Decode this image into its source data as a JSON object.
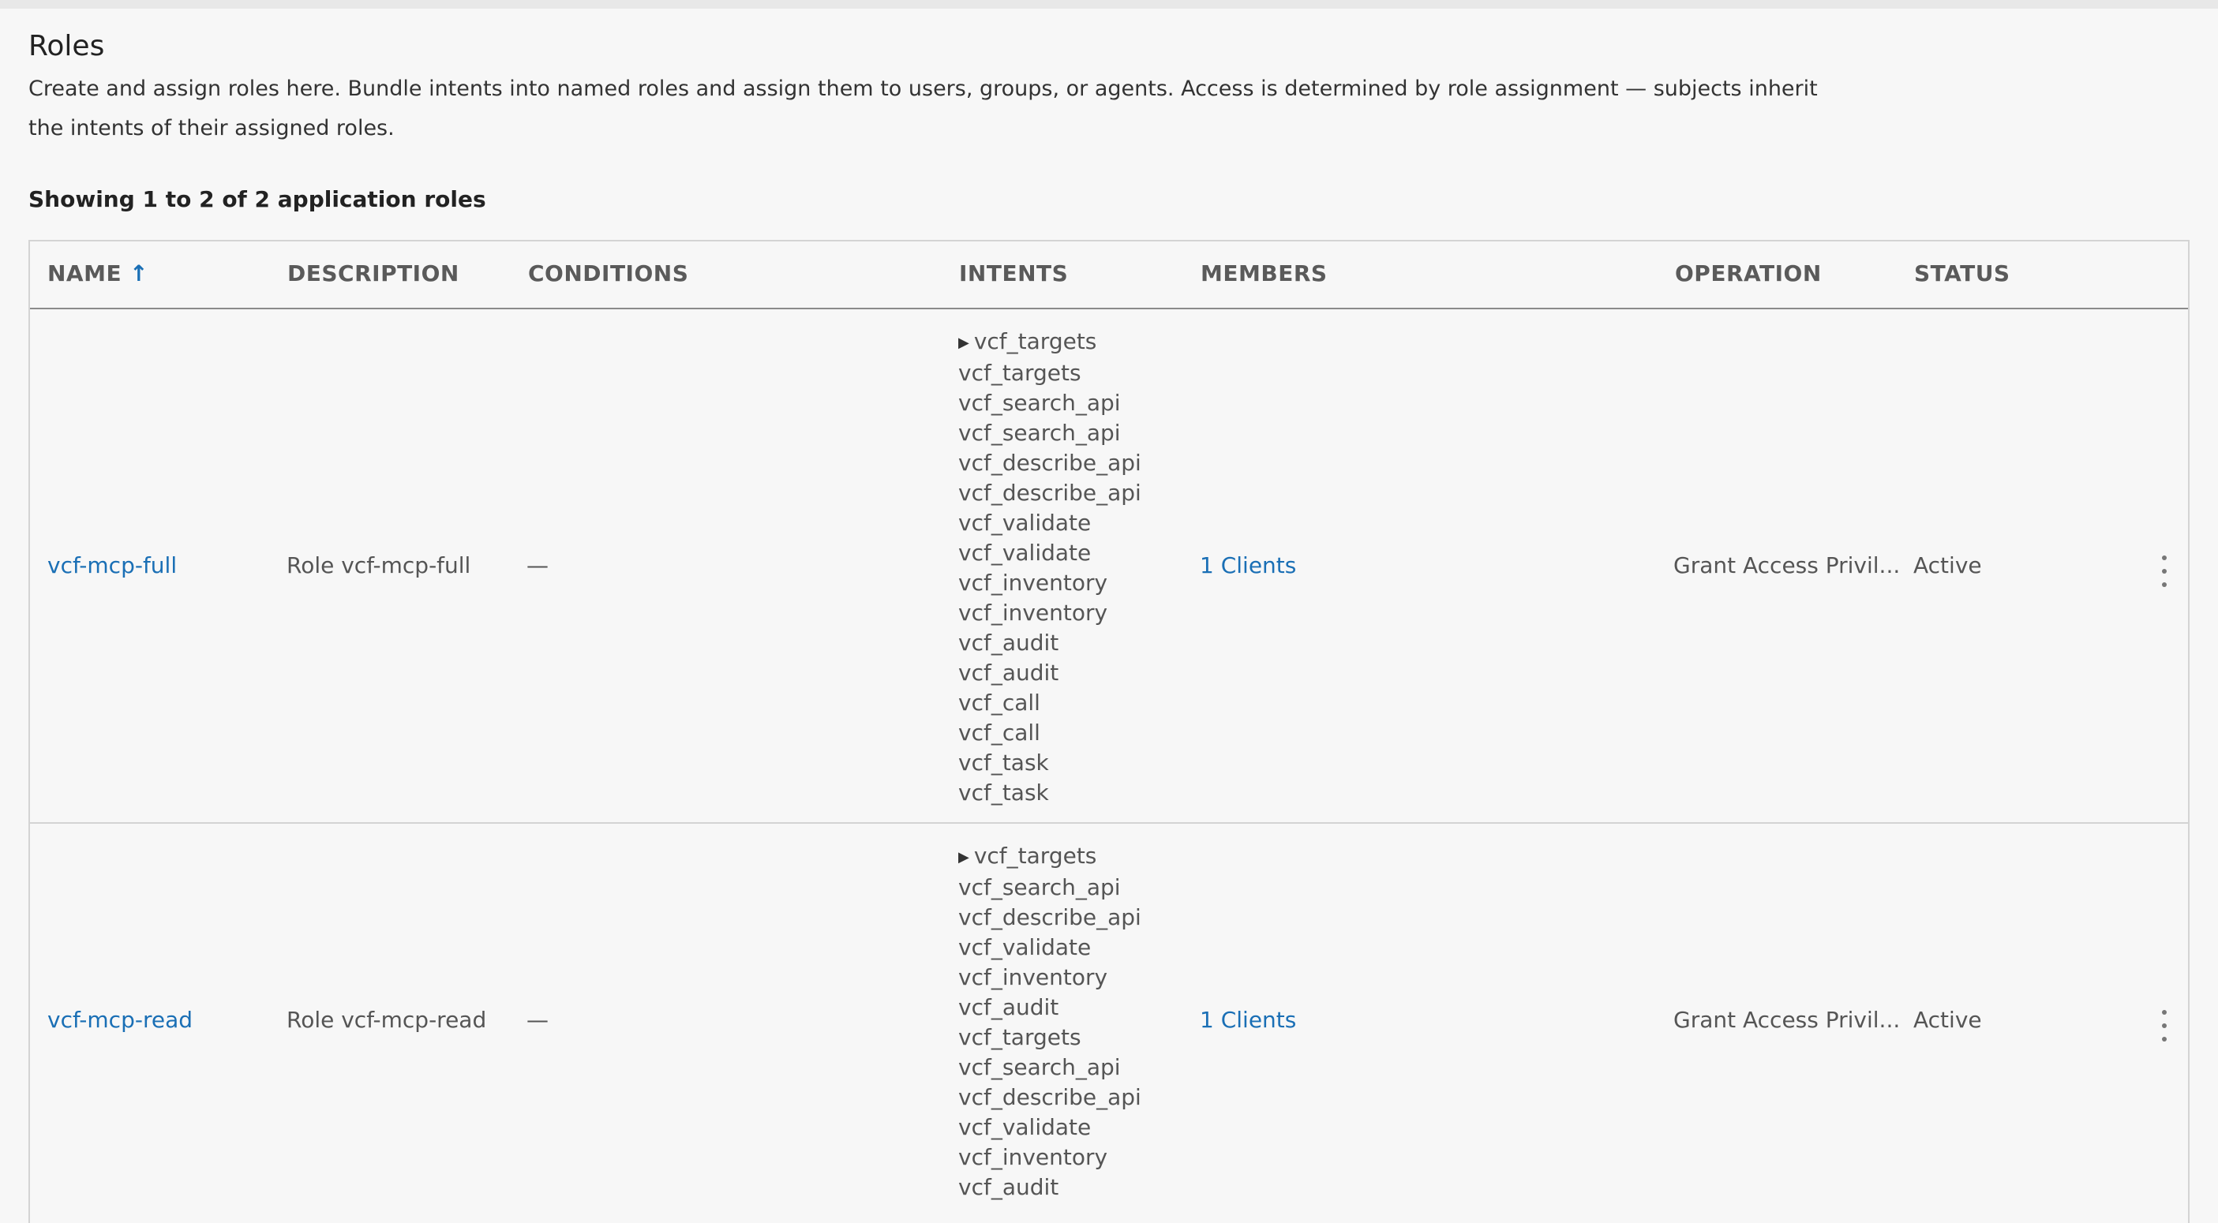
{
  "page": {
    "title": "Roles",
    "description": "Create and assign roles here. Bundle intents into named roles and assign them to users, groups, or agents. Access is determined by role assignment — subjects inherit the intents of their assigned roles.",
    "count_text": "Showing 1 to 2 of 2 application roles"
  },
  "table": {
    "headers": {
      "name": "NAME",
      "description": "DESCRIPTION",
      "conditions": "CONDITIONS",
      "intents": "INTENTS",
      "members": "MEMBERS",
      "operation": "OPERATION",
      "status": "STATUS"
    },
    "sort_icon": "↑",
    "rows": [
      {
        "name": "vcf-mcp-full",
        "description": "Role vcf-mcp-full",
        "conditions": "—",
        "intents": [
          "vcf_targets",
          "vcf_targets",
          "vcf_search_api",
          "vcf_search_api",
          "vcf_describe_api",
          "vcf_describe_api",
          "vcf_validate",
          "vcf_validate",
          "vcf_inventory",
          "vcf_inventory",
          "vcf_audit",
          "vcf_audit",
          "vcf_call",
          "vcf_call",
          "vcf_task",
          "vcf_task"
        ],
        "members": "1 Clients",
        "operation": "Grant Access Privil...",
        "status": "Active"
      },
      {
        "name": "vcf-mcp-read",
        "description": "Role vcf-mcp-read",
        "conditions": "—",
        "intents": [
          "vcf_targets",
          "vcf_search_api",
          "vcf_describe_api",
          "vcf_validate",
          "vcf_inventory",
          "vcf_audit",
          "vcf_targets",
          "vcf_search_api",
          "vcf_describe_api",
          "vcf_validate",
          "vcf_inventory",
          "vcf_audit"
        ],
        "members": "1 Clients",
        "operation": "Grant Access Privil...",
        "status": "Active"
      }
    ]
  },
  "icons": {
    "expand": "triangle-right-icon",
    "sort": "arrow-up-icon",
    "actions": "kebab-menu-icon"
  },
  "colors": {
    "link": "#1a6fb5",
    "background": "#f7f7f7"
  }
}
